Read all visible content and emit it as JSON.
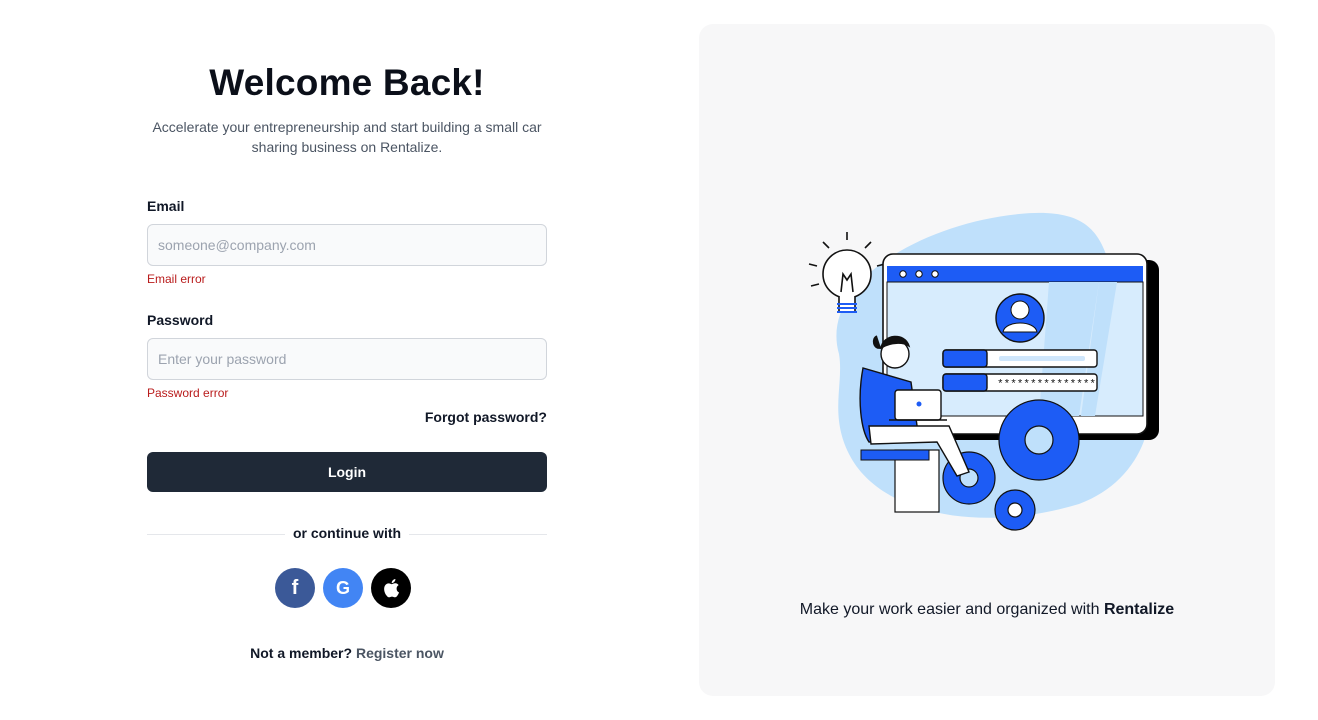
{
  "form": {
    "title": "Welcome Back!",
    "subtitle": "Accelerate your entrepreneurship and start building a small car sharing business on Rentalize.",
    "email_label": "Email",
    "email_placeholder": "someone@company.com",
    "email_value": "",
    "email_error": "Email error",
    "password_label": "Password",
    "password_placeholder": "Enter your password",
    "password_value": "",
    "password_error": "Password error",
    "forgot_label": "Forgot password?",
    "login_label": "Login",
    "divider_text": "or continue with",
    "social": [
      {
        "name": "facebook-icon",
        "glyph": "f"
      },
      {
        "name": "google-icon",
        "glyph": "G"
      },
      {
        "name": "apple-icon",
        "glyph": ""
      }
    ],
    "register_prompt": "Not a member?",
    "register_link": "Register now"
  },
  "panel": {
    "tagline_prefix": "Make your work easier and organized with",
    "tagline_brand": "Rentalize",
    "illustration": {
      "password_mask": "***************"
    }
  },
  "colors": {
    "accent": "#1f2937",
    "error": "#b91c1c",
    "facebook": "#3b5998",
    "google": "#4285f4",
    "apple": "#000000",
    "illustration_blue": "#1d5cf5",
    "illustration_light": "#bfe0fb"
  }
}
